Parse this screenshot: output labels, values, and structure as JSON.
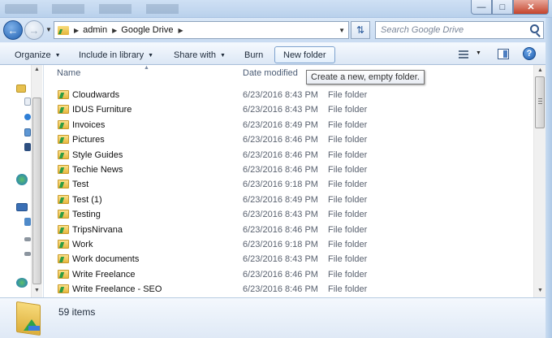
{
  "window": {
    "minimize_glyph": "—",
    "maximize_glyph": "□",
    "close_glyph": "✕"
  },
  "address": {
    "breadcrumbs": [
      "admin",
      "Google Drive"
    ],
    "search_placeholder": "Search Google Drive"
  },
  "toolbar": {
    "organize": "Organize",
    "include_in_library": "Include in library",
    "share_with": "Share with",
    "burn": "Burn",
    "new_folder": "New folder",
    "help": "?"
  },
  "columns": {
    "name": "Name",
    "date_modified": "Date modified",
    "size": "ze"
  },
  "tooltip": "Create a new, empty folder.",
  "files": [
    {
      "name": "Cloudwards",
      "date": "6/23/2016 8:43 PM",
      "type": "File folder"
    },
    {
      "name": "IDUS Furniture",
      "date": "6/23/2016 8:43 PM",
      "type": "File folder"
    },
    {
      "name": "Invoices",
      "date": "6/23/2016 8:49 PM",
      "type": "File folder"
    },
    {
      "name": "Pictures",
      "date": "6/23/2016 8:46 PM",
      "type": "File folder"
    },
    {
      "name": "Style Guides",
      "date": "6/23/2016 8:46 PM",
      "type": "File folder"
    },
    {
      "name": "Techie News",
      "date": "6/23/2016 8:46 PM",
      "type": "File folder"
    },
    {
      "name": "Test",
      "date": "6/23/2016 9:18 PM",
      "type": "File folder"
    },
    {
      "name": "Test (1)",
      "date": "6/23/2016 8:49 PM",
      "type": "File folder"
    },
    {
      "name": "Testing",
      "date": "6/23/2016 8:43 PM",
      "type": "File folder"
    },
    {
      "name": "TripsNirvana",
      "date": "6/23/2016 8:46 PM",
      "type": "File folder"
    },
    {
      "name": "Work",
      "date": "6/23/2016 9:18 PM",
      "type": "File folder"
    },
    {
      "name": "Work documents",
      "date": "6/23/2016 8:43 PM",
      "type": "File folder"
    },
    {
      "name": "Write Freelance",
      "date": "6/23/2016 8:46 PM",
      "type": "File folder"
    },
    {
      "name": "Write Freelance - SEO",
      "date": "6/23/2016 8:46 PM",
      "type": "File folder"
    }
  ],
  "details": {
    "item_count": "59 items"
  },
  "icons": {
    "folder": "google-drive-folder-icon",
    "search": "search-icon",
    "refresh": "refresh-icon",
    "help": "help-icon"
  },
  "colors": {
    "chrome": "#cadcf2",
    "accent": "#1f5fb0",
    "folder": "#e8b73f",
    "drive_green": "#2e9d43"
  }
}
